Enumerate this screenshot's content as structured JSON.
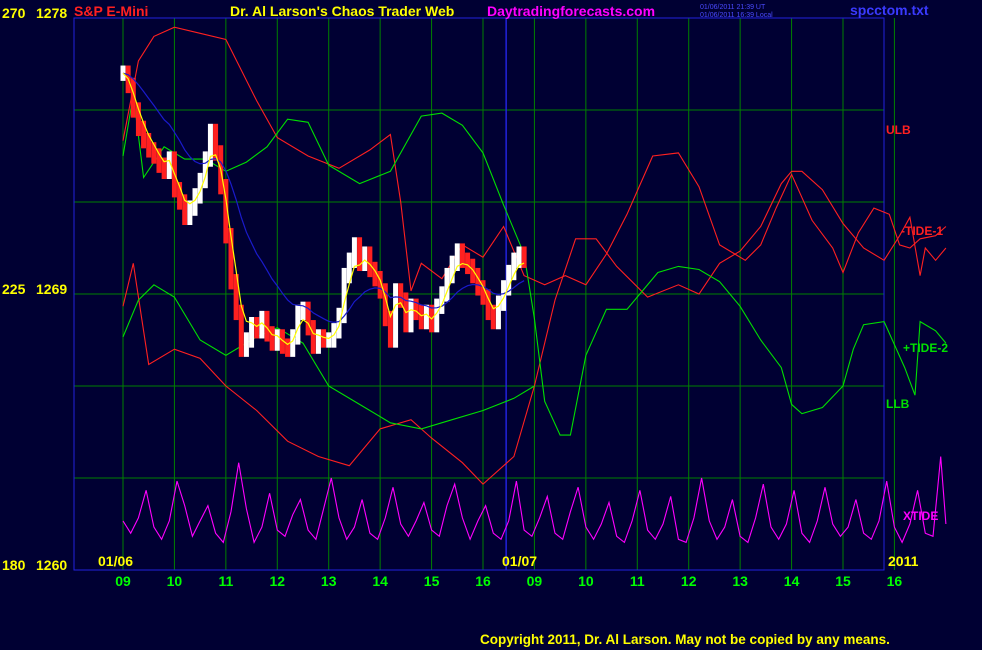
{
  "header": {
    "symbol": "S&P E-Mini",
    "title": "Dr. Al Larson's Chaos Trader Web",
    "site": "Daytradingforecasts.com",
    "ut_time": "01/06/2011 21:39 UT",
    "local_time": "01/06/2011 16:39 Local",
    "filename": "spcctom.txt"
  },
  "left_axis": {
    "top_code": "270",
    "top_price": "1278",
    "mid_code": "225",
    "mid_price": "1269",
    "bottom_code": "180",
    "bottom_price": "1260"
  },
  "dates": {
    "day1": "01/06",
    "day2": "01/07",
    "year": "2011"
  },
  "series_labels": {
    "ulb": "ULB",
    "tide1": "-TIDE-1",
    "tide2": "+TIDE-2",
    "llb": "LLB",
    "xtide": "XTIDE"
  },
  "footer": {
    "copyright": "Copyright 2011, Dr. Al Larson. May not be copied by any means."
  },
  "colors": {
    "background": "#000033",
    "grid": "#008000",
    "divider": "#2222dd",
    "red": "#ff2020",
    "green": "#00e000",
    "magenta": "#ff00ff",
    "yellow": "#ffff00",
    "date_green": "#00ff00",
    "ma_blue": "#1a1acc"
  },
  "chart_data": {
    "type": "line",
    "x_ticks": [
      "09",
      "10",
      "11",
      "12",
      "13",
      "14",
      "15",
      "16",
      "09",
      "10",
      "11",
      "12",
      "13",
      "14",
      "15",
      "16"
    ],
    "y_labels": [
      "270 1278",
      "225 1269",
      "180 1260"
    ],
    "ylim": [
      1260,
      1278
    ],
    "grid": true,
    "series": [
      {
        "name": "ULB",
        "color": "red",
        "x": [
          0,
          0.3,
          0.6,
          1,
          1.5,
          2,
          2.6,
          3.0,
          3.6,
          4.2,
          4.8,
          5.2,
          5.4,
          5.6,
          5.8,
          6.2,
          6.6,
          7,
          7.4,
          7.8,
          8.2,
          8.6,
          9,
          9.4,
          9.8,
          10.3,
          10.8,
          11.2,
          11.6,
          11.9,
          12.1,
          12.4,
          12.7,
          13.0,
          13.4,
          13.8,
          14.0,
          14.3,
          14.6,
          14.9,
          15.1,
          15.3,
          15.5,
          15.8,
          16
        ],
        "y": [
          1274.0,
          1276.6,
          1277.4,
          1277.7,
          1277.5,
          1277.3,
          1275.3,
          1274.1,
          1273.5,
          1273.1,
          1273.7,
          1274.2,
          1272.0,
          1269.1,
          1270.0,
          1269.5,
          1270.6,
          1270.2,
          1271.2,
          1269.6,
          1269.3,
          1269.6,
          1269.3,
          1270.3,
          1271.6,
          1273.5,
          1273.6,
          1272.5,
          1270.6,
          1270.3,
          1270.1,
          1270.6,
          1271.8,
          1272.9,
          1271.4,
          1270.5,
          1269.7,
          1271.0,
          1271.8,
          1271.6,
          1270.6,
          1270.5,
          1270.8,
          1270.9,
          1271.2
        ]
      },
      {
        "name": "TIDE-1",
        "color": "red",
        "x": [
          0,
          0.2,
          0.5,
          1,
          1.5,
          2,
          2.6,
          3.2,
          3.8,
          4.4,
          5.0,
          5.6,
          6.0,
          6.6,
          7,
          7.6,
          8,
          8.4,
          8.8,
          9.2,
          9.6,
          10.2,
          10.8,
          11.2,
          11.6,
          12.0,
          12.4,
          12.8,
          13.0,
          13.2,
          13.6,
          14.0,
          14.4,
          14.8,
          15.1,
          15.3,
          15.5,
          15.6,
          15.8,
          16
        ],
        "y": [
          1268.6,
          1270.0,
          1266.7,
          1267.2,
          1266.9,
          1266.0,
          1265.2,
          1264.2,
          1263.7,
          1263.4,
          1264.6,
          1264.9,
          1264.3,
          1263.5,
          1262.8,
          1263.7,
          1266.0,
          1268.8,
          1270.8,
          1270.8,
          1269.9,
          1268.9,
          1269.3,
          1269.0,
          1270.0,
          1270.4,
          1271.2,
          1272.6,
          1273.0,
          1273.0,
          1272.4,
          1271.3,
          1270.5,
          1270.1,
          1270.9,
          1271.5,
          1269.6,
          1270.5,
          1270.1,
          1270.5
        ]
      },
      {
        "name": "TIDE-2",
        "color": "green",
        "x": [
          0,
          0.2,
          0.4,
          0.8,
          1.2,
          1.6,
          2.0,
          2.4,
          2.8,
          3.2,
          3.6,
          4.0,
          4.6,
          5.2,
          5.8,
          6.2,
          6.6,
          7.0,
          7.4,
          7.8,
          8.0,
          8.2,
          8.5,
          8.7,
          9.0,
          9.4,
          9.8,
          10.4,
          10.8,
          11.2,
          11.6,
          12.0,
          12.4,
          12.8,
          13.0,
          13.2,
          13.6,
          14.0,
          14.2,
          14.4,
          14.8,
          15.2,
          15.4,
          15.5,
          15.8,
          16
        ],
        "y": [
          1273.5,
          1275.5,
          1272.8,
          1273.8,
          1273.4,
          1273.4,
          1273.0,
          1273.3,
          1273.8,
          1274.7,
          1274.6,
          1273.2,
          1272.6,
          1273.0,
          1274.8,
          1274.9,
          1274.5,
          1273.6,
          1271.9,
          1270.3,
          1268.2,
          1265.5,
          1264.4,
          1264.4,
          1267.0,
          1268.5,
          1268.5,
          1269.7,
          1269.9,
          1269.8,
          1269.4,
          1268.6,
          1267.5,
          1266.6,
          1265.4,
          1265.1,
          1265.3,
          1266.0,
          1267.2,
          1268.0,
          1268.1,
          1266.6,
          1265.7,
          1268.1,
          1267.8,
          1267.4
        ]
      },
      {
        "name": "LLB",
        "color": "green",
        "x": [
          0,
          0.3,
          0.6,
          1,
          1.5,
          2,
          2.6,
          3.0,
          3.5,
          4.0,
          4.6,
          5.2,
          5.8,
          6.4,
          7.0,
          7.6,
          8.0
        ],
        "y": [
          1267.6,
          1268.8,
          1269.3,
          1268.9,
          1267.5,
          1267.0,
          1267.6,
          1267.9,
          1267.4,
          1266.0,
          1265.4,
          1264.8,
          1264.6,
          1264.9,
          1265.2,
          1265.6,
          1266.0
        ]
      },
      {
        "name": "XTIDE",
        "color": "magenta",
        "x": [
          0,
          0.15,
          0.3,
          0.45,
          0.6,
          0.75,
          0.9,
          1.05,
          1.2,
          1.35,
          1.5,
          1.65,
          1.8,
          1.95,
          2.1,
          2.25,
          2.4,
          2.55,
          2.7,
          2.85,
          3.0,
          3.15,
          3.3,
          3.45,
          3.6,
          3.75,
          3.9,
          4.05,
          4.2,
          4.35,
          4.5,
          4.65,
          4.8,
          4.95,
          5.1,
          5.25,
          5.4,
          5.55,
          5.7,
          5.85,
          6.0,
          6.15,
          6.3,
          6.45,
          6.6,
          6.75,
          6.9,
          7.05,
          7.2,
          7.35,
          7.5,
          7.65,
          7.8,
          7.95,
          8.1,
          8.25,
          8.4,
          8.55,
          8.7,
          8.85,
          9.0,
          9.15,
          9.3,
          9.45,
          9.6,
          9.75,
          9.9,
          10.05,
          10.2,
          10.35,
          10.5,
          10.65,
          10.8,
          10.95,
          11.1,
          11.25,
          11.4,
          11.55,
          11.7,
          11.85,
          12.0,
          12.15,
          12.3,
          12.45,
          12.6,
          12.75,
          12.9,
          13.05,
          13.2,
          13.35,
          13.5,
          13.65,
          13.8,
          13.95,
          14.1,
          14.25,
          14.4,
          14.55,
          14.7,
          14.85,
          15.0,
          15.15,
          15.3,
          15.45,
          15.6,
          15.75,
          15.9,
          16
        ],
        "y": [
          1261.6,
          1261.2,
          1261.7,
          1262.6,
          1261.4,
          1261.0,
          1261.6,
          1262.9,
          1262.1,
          1261.1,
          1261.6,
          1262.1,
          1261.2,
          1260.9,
          1261.9,
          1263.5,
          1262.0,
          1260.9,
          1261.4,
          1262.5,
          1261.3,
          1261.1,
          1261.8,
          1262.3,
          1261.3,
          1261.0,
          1262.0,
          1263.0,
          1261.7,
          1261.0,
          1261.4,
          1262.3,
          1261.2,
          1261.0,
          1261.7,
          1262.7,
          1261.5,
          1261.1,
          1261.6,
          1262.2,
          1261.3,
          1261.1,
          1262.1,
          1262.8,
          1261.7,
          1261.0,
          1261.6,
          1262.1,
          1261.2,
          1261.0,
          1261.6,
          1262.9,
          1261.3,
          1261.1,
          1261.7,
          1262.4,
          1261.2,
          1261.0,
          1261.9,
          1262.7,
          1261.4,
          1261.0,
          1261.5,
          1262.2,
          1261.1,
          1260.9,
          1261.6,
          1262.6,
          1261.3,
          1261.0,
          1261.5,
          1262.4,
          1261.0,
          1260.9,
          1261.7,
          1263.0,
          1261.6,
          1261.0,
          1261.4,
          1262.3,
          1261.1,
          1260.9,
          1261.7,
          1262.8,
          1261.4,
          1261.0,
          1261.5,
          1262.6,
          1261.2,
          1260.9,
          1261.6,
          1262.7,
          1261.5,
          1261.1,
          1261.4,
          1262.3,
          1261.2,
          1261.0,
          1261.6,
          1262.9,
          1261.4,
          1260.9,
          1261.5,
          1262.6,
          1261.2,
          1261.1,
          1263.7,
          1261.5
        ]
      },
      {
        "name": "PRICE",
        "color": "white/red bars",
        "x": [
          0,
          0.1,
          0.2,
          0.3,
          0.4,
          0.5,
          0.6,
          0.7,
          0.8,
          0.9,
          1.0,
          1.1,
          1.2,
          1.3,
          1.4,
          1.5,
          1.6,
          1.7,
          1.8,
          1.9,
          2.0,
          2.1,
          2.2,
          2.3,
          2.4,
          2.5,
          2.6,
          2.7,
          2.8,
          2.9,
          3.0,
          3.1,
          3.2,
          3.3,
          3.4,
          3.5,
          3.6,
          3.7,
          3.8,
          3.9,
          4.0,
          4.1,
          4.2,
          4.3,
          4.4,
          4.5,
          4.6,
          4.7,
          4.8,
          4.9,
          5.0,
          5.1,
          5.2,
          5.3,
          5.4,
          5.5,
          5.6,
          5.7,
          5.8,
          5.9,
          6.0,
          6.1,
          6.2,
          6.3,
          6.4,
          6.5,
          6.6,
          6.7,
          6.8,
          6.9,
          7.0,
          7.1,
          7.2,
          7.3,
          7.4,
          7.5,
          7.6,
          7.7,
          7.8
        ],
        "y": [
          1276.2,
          1275.8,
          1275.0,
          1274.4,
          1274.0,
          1273.7,
          1273.5,
          1273.2,
          1273.0,
          1273.4,
          1272.4,
          1272.0,
          1271.5,
          1271.8,
          1272.2,
          1272.7,
          1273.4,
          1274.3,
          1273.6,
          1272.5,
          1270.9,
          1269.4,
          1268.4,
          1267.2,
          1267.5,
          1268.0,
          1267.8,
          1268.2,
          1267.7,
          1267.4,
          1267.6,
          1267.3,
          1267.2,
          1267.6,
          1268.4,
          1268.5,
          1267.9,
          1267.3,
          1267.6,
          1267.5,
          1267.5,
          1267.8,
          1268.3,
          1269.6,
          1270.1,
          1270.6,
          1270.0,
          1270.3,
          1269.8,
          1269.5,
          1269.1,
          1268.2,
          1267.5,
          1269.1,
          1268.8,
          1268.0,
          1268.6,
          1268.4,
          1268.1,
          1268.4,
          1268.0,
          1268.6,
          1269.0,
          1269.6,
          1270.0,
          1270.4,
          1270.1,
          1269.9,
          1269.6,
          1269.2,
          1268.9,
          1268.4,
          1268.1,
          1268.7,
          1269.2,
          1269.7,
          1270.1,
          1270.3,
          1270.1
        ]
      }
    ]
  }
}
